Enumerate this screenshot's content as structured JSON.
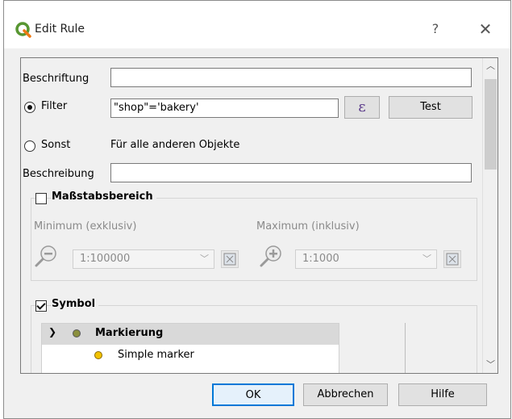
{
  "window": {
    "title": "Edit Rule",
    "help_label": "?",
    "close_label": "✕"
  },
  "form": {
    "caption_label": "Beschriftung",
    "caption_value": "",
    "filter_label": "Filter",
    "filter_value": "\"shop\"='bakery'",
    "filter_selected": true,
    "expression_label": "ε",
    "test_label": "Test",
    "else_label": "Sonst",
    "else_text": "Für alle anderen Objekte",
    "description_label": "Beschreibung",
    "description_value": ""
  },
  "scale": {
    "title": "Maßstabsbereich",
    "checked": false,
    "min_label": "Minimum (exklusiv)",
    "min_value": "1:100000",
    "max_label": "Maximum (inklusiv)",
    "max_value": "1:1000"
  },
  "symbol": {
    "title": "Symbol",
    "checked": true,
    "tree": [
      {
        "label": "Markierung",
        "bold": true,
        "color": "#8a8f3c"
      },
      {
        "label": "Simple marker",
        "bold": false,
        "color": "#f2c200"
      }
    ]
  },
  "footer": {
    "ok_label": "OK",
    "cancel_label": "Abbrechen",
    "help_label": "Hilfe"
  },
  "icons": {
    "app": "qgis-logo-icon",
    "expression": "epsilon-icon",
    "zoom_out": "zoom-out-icon",
    "zoom_in": "zoom-in-icon",
    "map_canvas": "map-canvas-icon"
  },
  "colors": {
    "accent": "#0078d7",
    "qgis_green": "#589632",
    "qgis_yellow": "#ee7913"
  }
}
